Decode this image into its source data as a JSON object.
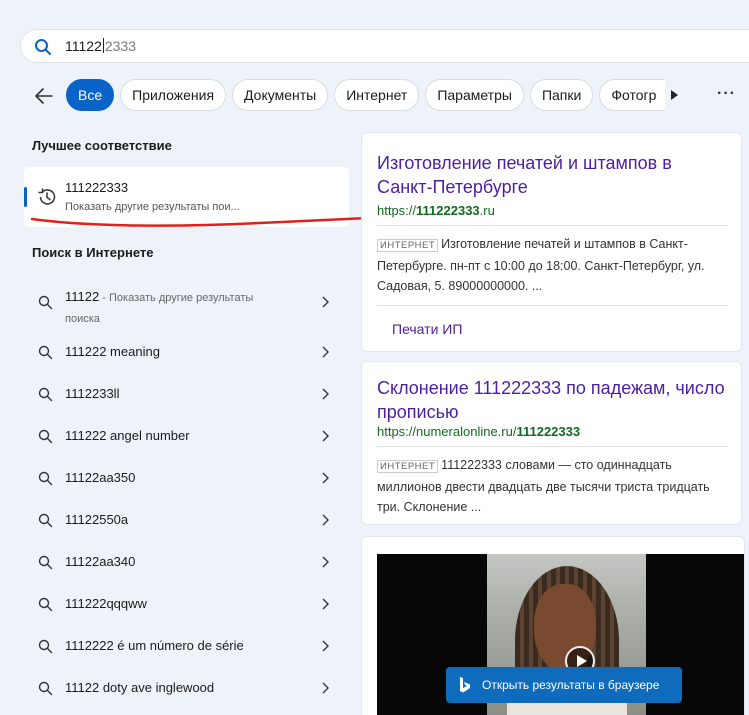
{
  "search": {
    "typed": "11122",
    "remainder": "2333"
  },
  "tabs": [
    "Все",
    "Приложения",
    "Документы",
    "Интернет",
    "Параметры",
    "Папки",
    "Фотогр"
  ],
  "best_match": {
    "section_title": "Лучшее соответствие",
    "title": "111222333",
    "subtitle": "Показать другие результаты пои..."
  },
  "web_search": {
    "section_title": "Поиск в Интернете",
    "first": {
      "query": "11122",
      "suffix": " - Показать другие результаты",
      "suffix2": "поиска"
    },
    "items": [
      "111222 meaning",
      "1112233ll",
      "111222 angel number",
      "11122aa350",
      "11122550a",
      "11122aa340",
      "111222qqqww",
      "1112222 é um número de série",
      "11122 doty ave inglewood"
    ]
  },
  "results": [
    {
      "title": "Изготовление печатей и штампов в Санкт-Петербурге",
      "url_prefix": "https://",
      "url_bold": "111222333",
      "url_suffix": ".ru",
      "tag": "ИНТЕРНЕТ",
      "snippet": "Изготовление печатей и штампов в Санкт-Петербурге. пн-пт с 10:00 до 18:00. Санкт-Петербург, ул. Садовая, 5. 89000000000. ...",
      "deep_link": "Печати ИП"
    },
    {
      "title": "Склонение 111222333 по падежам, число прописью",
      "url_prefix": "https://numeralonline.ru/",
      "url_bold": "111222333",
      "url_suffix": "",
      "tag": "ИНТЕРНЕТ",
      "snippet": "111222333 словами — сто одиннадцать миллионов двести двадцать две тысячи триста тридцать три. Склонение ..."
    }
  ],
  "open_in_browser": "Открыть результаты в браузере",
  "colors": {
    "accent": "#0a63c9",
    "link": "#4b1fa0",
    "url": "#106b21",
    "annotation": "#e0201c"
  }
}
